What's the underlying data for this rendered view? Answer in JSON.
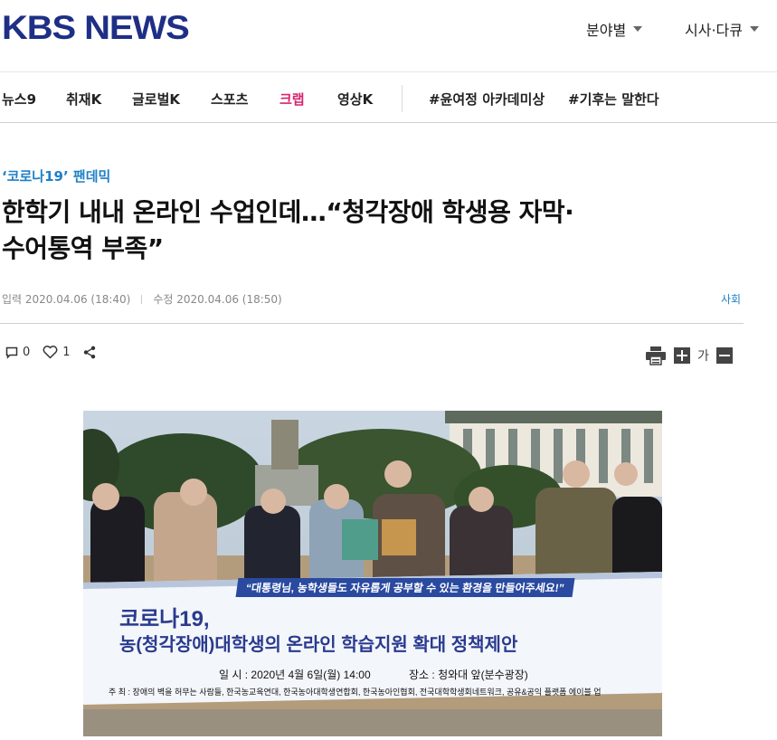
{
  "header": {
    "logo": "KBS NEWS",
    "menu": [
      {
        "label": "분야별"
      },
      {
        "label": "시사·다큐"
      }
    ]
  },
  "nav": {
    "items": [
      "뉴스9",
      "취재K",
      "글로벌K",
      "스포츠",
      "크랩",
      "영상K"
    ],
    "tags": [
      "#윤여정 아카데미상",
      "#기후는 말한다"
    ]
  },
  "article": {
    "category": "‘코로나19’ 팬데믹",
    "title_line1": "한학기 내내 온라인 수업인데…“청각장애 학생용 자막·",
    "title_line2": "수어통역 부족”",
    "input_label": "입력 2020.04.06 (18:40)",
    "edit_label": "수정 2020.04.06 (18:50)",
    "section": "사회",
    "comment_count": "0",
    "like_count": "1",
    "font_char": "가"
  },
  "photo": {
    "banner_quote": "“대통령님, 농학생들도 자유롭게 공부할 수 있는 환경을 만들어주세요!”",
    "banner_title1": "코로나19,",
    "banner_title2": "농(청각장애)대학생의 온라인 학습지원 확대 정책제안",
    "banner_when": "일 시 : 2020년 4월 6일(월) 14:00",
    "banner_where": "장소 : 청와대 앞(분수광장)",
    "banner_host": "주 최 : 장애의 벽을 허무는 사람들, 한국농교육연대, 한국농아대학생연합회, 한국농아인협회, 전국대학학생회네트워크, 공유&공익 플랫폼 에이블 업"
  },
  "colors": {
    "logo": "#1e2f86",
    "category": "#1e80c6",
    "clip": "#d6246e",
    "banner_text": "#2a3a8f"
  }
}
